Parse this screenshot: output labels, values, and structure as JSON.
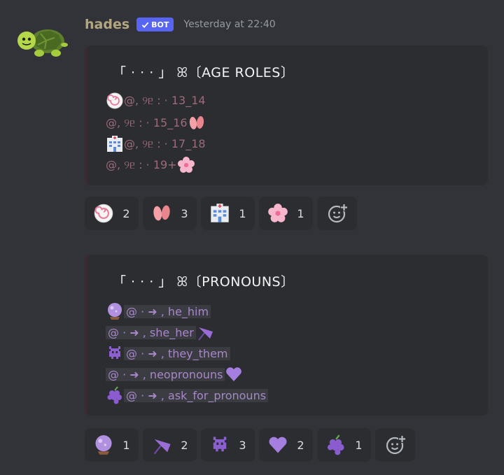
{
  "message": {
    "username": "hades",
    "bot_badge": "BOT",
    "timestamp": "Yesterday at 22:40",
    "avatar_icon": "turtle-icon"
  },
  "embeds": [
    {
      "title": "「 · · · 」 ꕤ〔AGE ROLES〕",
      "lines": [
        {
          "text": "@, ୨ᥱ : · 13_14",
          "icon": "fishcake-icon"
        },
        {
          "text": "@, ୨ᥱ : · 15_16",
          "icon": "footprints-icon"
        },
        {
          "text": "@, ୨ᥱ : · 17_18",
          "icon": "hospital-icon"
        },
        {
          "text": "@, ୨ᥱ : · 19+",
          "icon": "cherry-blossom-icon"
        }
      ]
    },
    {
      "title": "「 · · · 」 ꕤ〔PRONOUNS〕",
      "lines": [
        {
          "text": "@ · ➜ , he_him",
          "icon": "crystal-ball-icon"
        },
        {
          "text": "@ · ➜ , she_her",
          "icon": "umbrella-icon"
        },
        {
          "text": "@ · ➜ , they_them",
          "icon": "alien-monster-icon"
        },
        {
          "text": "@ · ➜ , neopronouns",
          "icon": "purple-heart-icon"
        },
        {
          "text": "@ · ➜ , ask_for_pronouns",
          "icon": "grapes-icon"
        }
      ]
    }
  ],
  "reactions_age": [
    {
      "icon": "fishcake-icon",
      "count": "2"
    },
    {
      "icon": "footprints-icon",
      "count": "3"
    },
    {
      "icon": "hospital-icon",
      "count": "1"
    },
    {
      "icon": "cherry-blossom-icon",
      "count": "1"
    }
  ],
  "reactions_pronouns": [
    {
      "icon": "crystal-ball-icon",
      "count": "1"
    },
    {
      "icon": "umbrella-icon",
      "count": "2"
    },
    {
      "icon": "alien-monster-icon",
      "count": "3"
    },
    {
      "icon": "purple-heart-icon",
      "count": "2"
    },
    {
      "icon": "grapes-icon",
      "count": "1"
    }
  ],
  "add_reaction_icon": "add-reaction-icon",
  "colors": {
    "background": "#313338",
    "embed_background": "#2b2d31",
    "username": "#b3a77f",
    "bot_badge": "#5865f2",
    "age_role_text": "#9c6a7a",
    "pronoun_role_text": "#a887c9"
  }
}
